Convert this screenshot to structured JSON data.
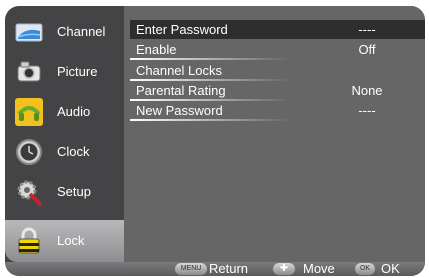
{
  "sidebar": {
    "items": [
      {
        "label": "Channel",
        "icon": "channel-icon"
      },
      {
        "label": "Picture",
        "icon": "picture-icon"
      },
      {
        "label": "Audio",
        "icon": "audio-icon"
      },
      {
        "label": "Clock",
        "icon": "clock-icon"
      },
      {
        "label": "Setup",
        "icon": "setup-icon"
      },
      {
        "label": "Lock",
        "icon": "lock-icon"
      }
    ],
    "selected": "Lock"
  },
  "menu": {
    "rows": [
      {
        "label": "Enter Password",
        "value": "----"
      },
      {
        "label": "Enable",
        "value": "Off"
      },
      {
        "label": "Channel Locks",
        "value": ""
      },
      {
        "label": "Parental Rating",
        "value": "None"
      },
      {
        "label": "New Password",
        "value": "----"
      }
    ],
    "highlighted": "Enter Password"
  },
  "bottom": {
    "return_key": "MENU",
    "return_label": "Return",
    "move_key": "✚",
    "move_label": "Move",
    "ok_key": "OK",
    "ok_label": "OK"
  },
  "colors": {
    "frame": "#444446",
    "panel": "#666667",
    "highlight": "#2e2e30",
    "text": "#ffffff"
  }
}
